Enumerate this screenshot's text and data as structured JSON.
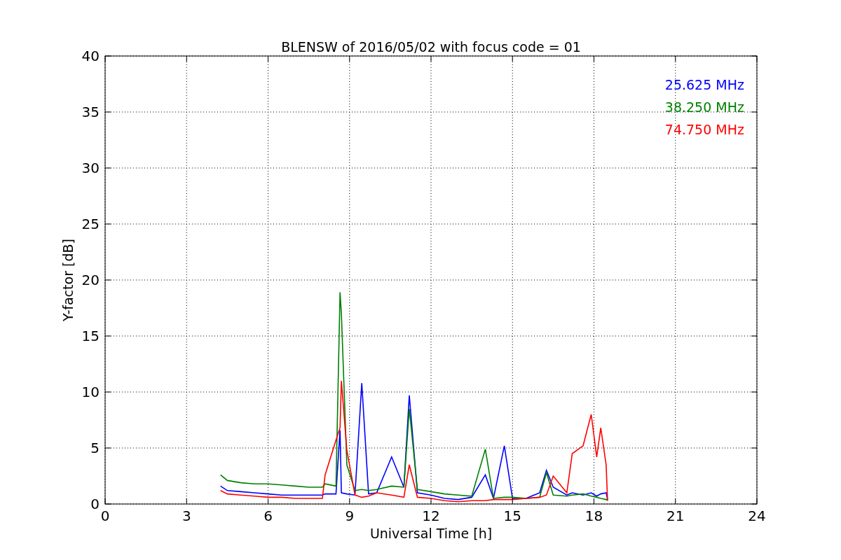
{
  "chart_data": {
    "type": "line",
    "title": "BLENSW of 2016/05/02 with focus code = 01",
    "xlabel": "Universal Time [h]",
    "ylabel": "Y-factor [dB]",
    "x": [
      4.25,
      4.5,
      5,
      5.5,
      6,
      6.5,
      7,
      7.5,
      8,
      8.1,
      8.5,
      8.65,
      8.7,
      8.9,
      9.2,
      9.45,
      9.7,
      10,
      10.55,
      11,
      11.2,
      11.5,
      12,
      12.5,
      13,
      13.5,
      14,
      14.3,
      14.7,
      15,
      15.5,
      16,
      16.25,
      16.5,
      17,
      17.2,
      17.6,
      17.9,
      18.1,
      18.25,
      18.45,
      18.5
    ],
    "series": [
      {
        "name": "25.625 MHz",
        "color": "#0000ff",
        "values": [
          1.6,
          1.2,
          1.1,
          1.0,
          0.9,
          0.8,
          0.8,
          0.8,
          0.8,
          0.9,
          0.9,
          6.6,
          1.0,
          0.9,
          0.8,
          10.8,
          0.9,
          1.0,
          4.2,
          1.5,
          9.7,
          1.0,
          0.8,
          0.5,
          0.4,
          0.6,
          2.6,
          0.5,
          5.2,
          0.5,
          0.5,
          1.0,
          3.0,
          1.5,
          0.8,
          1.0,
          0.8,
          1.0,
          0.7,
          0.9,
          1.0,
          0.4
        ]
      },
      {
        "name": "38.250 MHz",
        "color": "#008000",
        "values": [
          2.6,
          2.1,
          1.9,
          1.8,
          1.8,
          1.7,
          1.6,
          1.5,
          1.5,
          1.8,
          1.6,
          18.9,
          17,
          3.5,
          1.2,
          1.3,
          1.2,
          1.3,
          1.6,
          1.5,
          8.5,
          1.3,
          1.1,
          0.9,
          0.8,
          0.7,
          4.9,
          0.5,
          0.6,
          0.6,
          0.5,
          0.6,
          2.8,
          0.8,
          0.7,
          0.8,
          0.9,
          0.7,
          0.6,
          0.5,
          0.4,
          0.3
        ]
      },
      {
        "name": "74.750 MHz",
        "color": "#ff0000",
        "values": [
          1.2,
          0.9,
          0.8,
          0.7,
          0.6,
          0.6,
          0.5,
          0.5,
          0.5,
          2.6,
          5.7,
          6.8,
          11,
          4.8,
          0.8,
          0.6,
          0.7,
          1.0,
          0.8,
          0.6,
          3.5,
          0.6,
          0.5,
          0.3,
          0.2,
          0.3,
          0.3,
          0.4,
          0.4,
          0.4,
          0.5,
          0.6,
          0.8,
          2.5,
          1.0,
          4.5,
          5.2,
          8.0,
          4.2,
          6.8,
          3.5,
          0.3
        ]
      }
    ],
    "xlim": [
      0,
      24
    ],
    "ylim": [
      0,
      40
    ],
    "xticks": [
      0,
      3,
      6,
      9,
      12,
      15,
      18,
      21,
      24
    ],
    "yticks": [
      0,
      5,
      10,
      15,
      20,
      25,
      30,
      35,
      40
    ],
    "grid": true
  }
}
